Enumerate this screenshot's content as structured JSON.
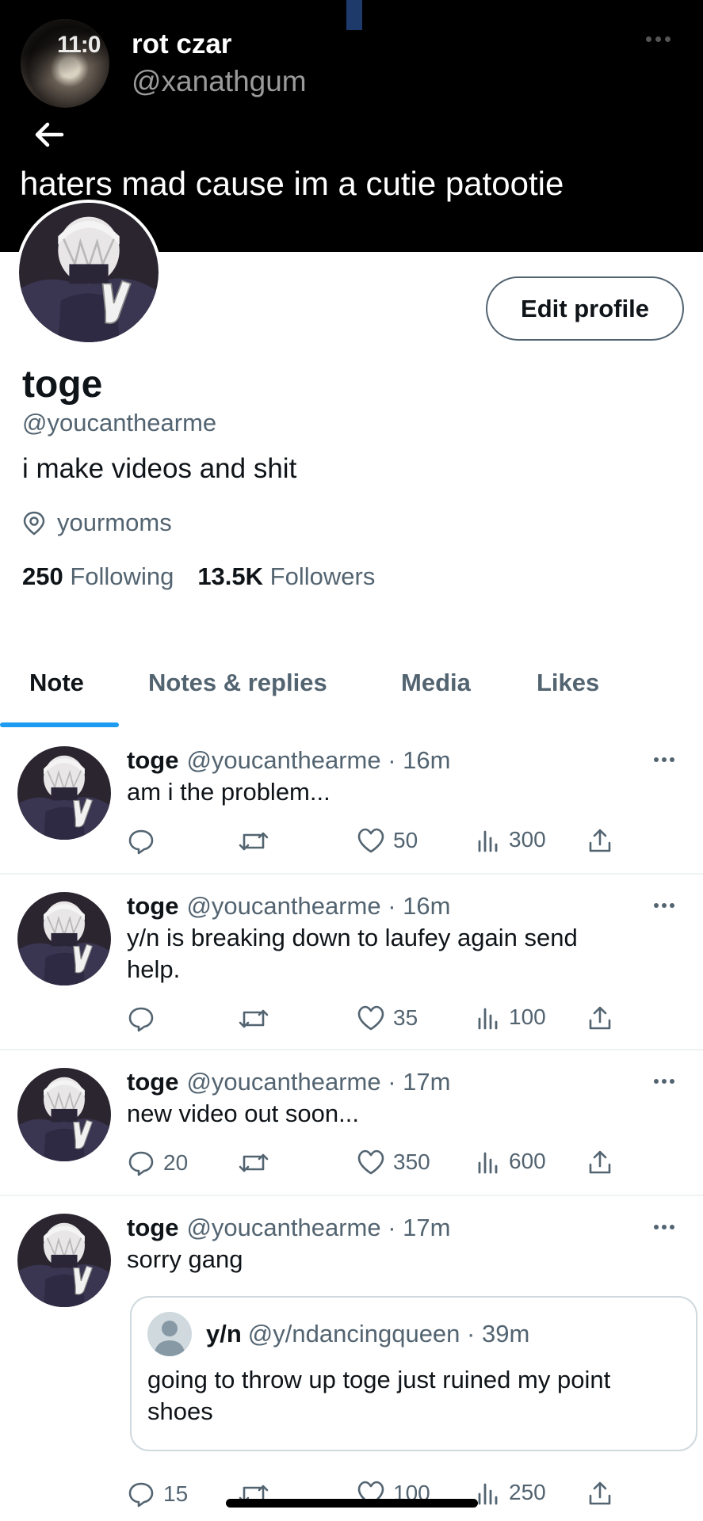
{
  "status_bar": {
    "time": "11:0"
  },
  "banner": {
    "name": "rot czar",
    "handle": "@xanathgum",
    "caption": "haters mad cause im a cutie patootie"
  },
  "profile": {
    "edit_label": "Edit profile",
    "display_name": "toge",
    "handle": "@youcanthearme",
    "bio": "i make videos and shit",
    "location": "yourmoms",
    "following_count": "250",
    "following_label": "Following",
    "followers_count": "13.5K",
    "followers_label": "Followers"
  },
  "tabs": [
    {
      "label": "Note",
      "active": true
    },
    {
      "label": "Notes & replies"
    },
    {
      "label": "Media"
    },
    {
      "label": "Likes"
    }
  ],
  "tweets": [
    {
      "name": "toge",
      "meta": "@youcanthearme · 16m",
      "text": "am i the problem...",
      "replies": "",
      "retweets": "",
      "likes": "50",
      "views": "300"
    },
    {
      "name": "toge",
      "meta": "@youcanthearme · 16m",
      "text": "y/n is breaking down to laufey again send help.",
      "replies": "",
      "retweets": "",
      "likes": "35",
      "views": "100"
    },
    {
      "name": "toge",
      "meta": "@youcanthearme · 17m",
      "text": "new video out soon...",
      "replies": "20",
      "retweets": "",
      "likes": "350",
      "views": "600"
    },
    {
      "name": "toge",
      "meta": "@youcanthearme · 17m",
      "text": "sorry gang",
      "quote": {
        "name": "y/n",
        "meta": "@y/ndancingqueen · 39m",
        "text": "going to throw up toge just ruined my point shoes"
      },
      "replies": "15",
      "retweets": "",
      "likes": "100",
      "views": "250"
    }
  ],
  "colors": {
    "accent": "#1d9bf0",
    "secondary_text": "#536471",
    "primary_text": "#0f1419"
  }
}
